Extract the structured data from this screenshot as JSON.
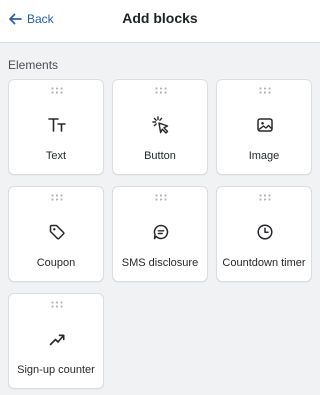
{
  "header": {
    "back_label": "Back",
    "back_icon": "arrow-left-icon",
    "title": "Add blocks",
    "accent_color": "#2a5ea6"
  },
  "section": {
    "label": "Elements"
  },
  "blocks": [
    {
      "label": "Text",
      "icon": "text-icon"
    },
    {
      "label": "Button",
      "icon": "cursor-click-icon"
    },
    {
      "label": "Image",
      "icon": "image-icon"
    },
    {
      "label": "Coupon",
      "icon": "tag-icon"
    },
    {
      "label": "SMS disclosure",
      "icon": "chat-bubble-icon"
    },
    {
      "label": "Countdown timer",
      "icon": "clock-icon"
    },
    {
      "label": "Sign-up counter",
      "icon": "trend-up-icon"
    }
  ]
}
